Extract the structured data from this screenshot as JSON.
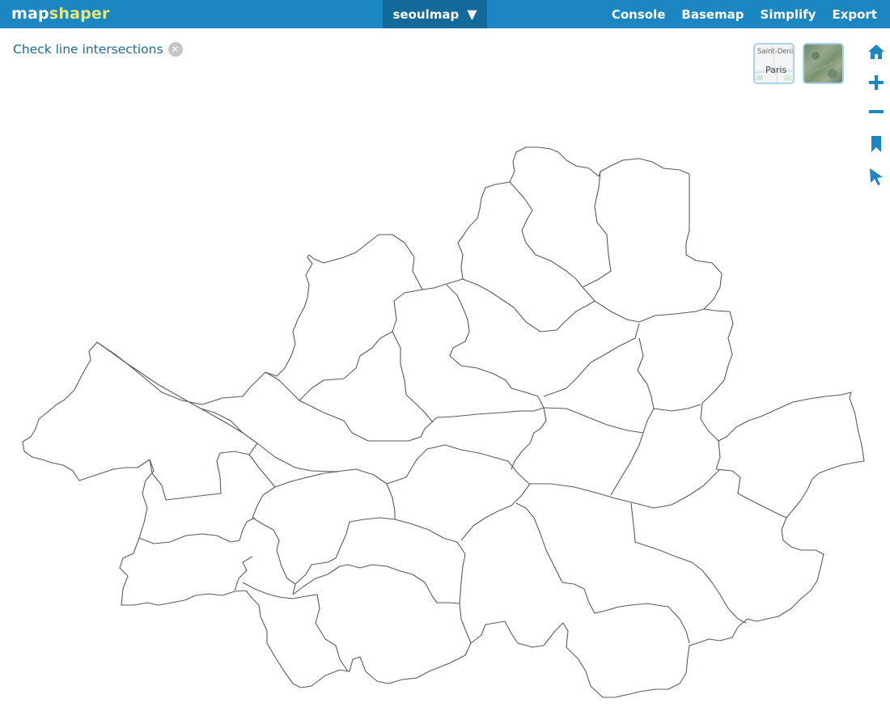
{
  "app": {
    "logo_part1": "map",
    "logo_part2": "shaper",
    "logo_color2": "#e6e97a"
  },
  "layer_menu": {
    "name": "seoulmap",
    "caret": "▼"
  },
  "nav": {
    "console": "Console",
    "basemap": "Basemap",
    "simplify": "Simplify",
    "export": "Export"
  },
  "notice": {
    "text": "Check line intersections",
    "close_icon": "close-icon"
  },
  "basemaps": {
    "street_label_1": "Saint-Deni",
    "street_label_2": "Paris"
  },
  "tools": [
    "home-icon",
    "zoom-in-icon",
    "zoom-out-icon",
    "bookmark-icon",
    "pointer-icon"
  ],
  "colors": {
    "bar": "#1a87c2",
    "layer_menu_bg": "#126a9b",
    "accent": "#1a87c2",
    "boundary": "#555a63"
  }
}
